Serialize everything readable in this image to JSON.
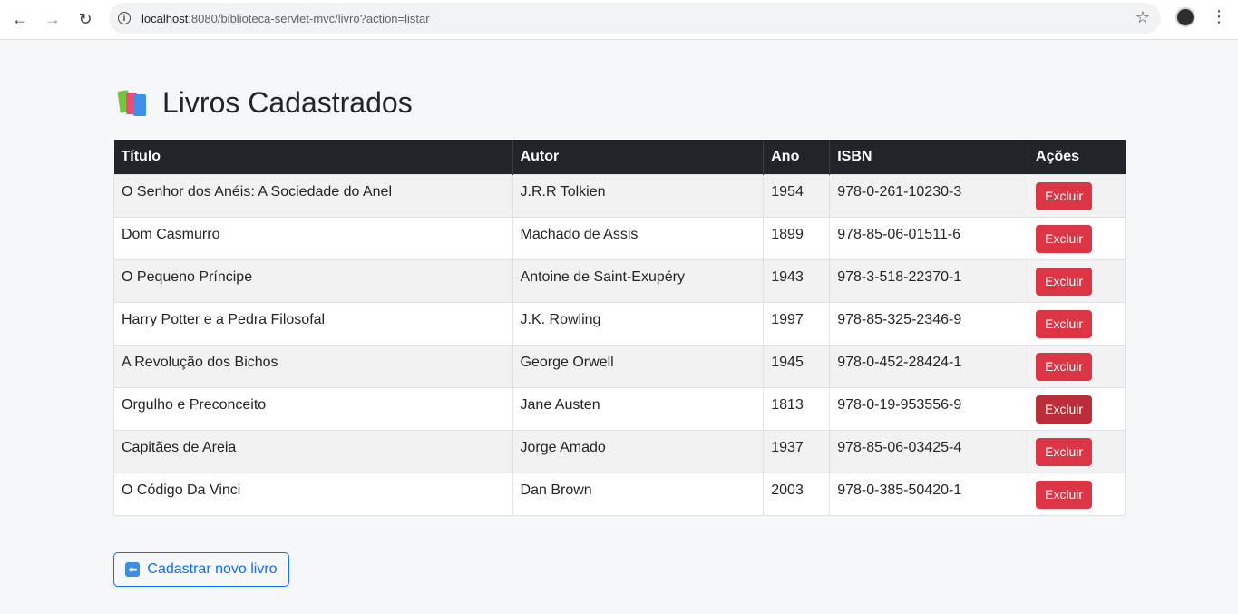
{
  "browser": {
    "url_host": "localhost",
    "url_rest": ":8080/biblioteca-servlet-mvc/livro?action=listar"
  },
  "page": {
    "title": "Livros Cadastrados",
    "columns": [
      "Título",
      "Autor",
      "Ano",
      "ISBN",
      "Ações"
    ],
    "rows": [
      {
        "titulo": "O Senhor dos Anéis: A Sociedade do Anel",
        "autor": "J.R.R Tolkien",
        "ano": "1954",
        "isbn": "978-0-261-10230-3",
        "acao": "Excluir"
      },
      {
        "titulo": "Dom Casmurro",
        "autor": "Machado de Assis",
        "ano": "1899",
        "isbn": "978-85-06-01511-6",
        "acao": "Excluir"
      },
      {
        "titulo": "O Pequeno Príncipe",
        "autor": "Antoine de Saint-Exupéry",
        "ano": "1943",
        "isbn": "978-3-518-22370-1",
        "acao": "Excluir"
      },
      {
        "titulo": "Harry Potter e a Pedra Filosofal",
        "autor": "J.K. Rowling",
        "ano": "1997",
        "isbn": "978-85-325-2346-9",
        "acao": "Excluir"
      },
      {
        "titulo": "A Revolução dos Bichos",
        "autor": "George Orwell",
        "ano": "1945",
        "isbn": "978-0-452-28424-1",
        "acao": "Excluir"
      },
      {
        "titulo": "Orgulho e Preconceito",
        "autor": "Jane Austen",
        "ano": "1813",
        "isbn": "978-0-19-953556-9",
        "acao": "Excluir"
      },
      {
        "titulo": "Capitães de Areia",
        "autor": "Jorge Amado",
        "ano": "1937",
        "isbn": "978-85-06-03425-4",
        "acao": "Excluir"
      },
      {
        "titulo": "O Código Da Vinci",
        "autor": "Dan Brown",
        "ano": "2003",
        "isbn": "978-0-385-50420-1",
        "acao": "Excluir"
      }
    ],
    "back_button": "Cadastrar novo livro"
  },
  "colors": {
    "header_bg": "#212529",
    "danger": "#dc3545",
    "danger_hover": "#bb2d3b",
    "primary": "#0d6efd"
  }
}
